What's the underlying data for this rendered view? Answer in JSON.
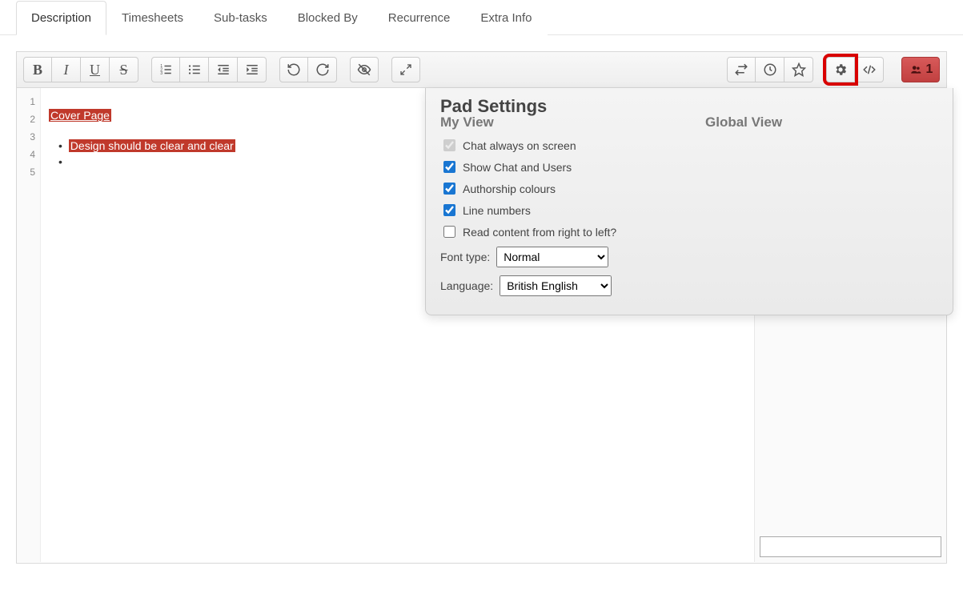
{
  "tabs": [
    {
      "label": "Description",
      "active": true
    },
    {
      "label": "Timesheets",
      "active": false
    },
    {
      "label": "Sub-tasks",
      "active": false
    },
    {
      "label": "Blocked By",
      "active": false
    },
    {
      "label": "Recurrence",
      "active": false
    },
    {
      "label": "Extra Info",
      "active": false
    }
  ],
  "toolbar": {
    "bold": "B",
    "italic": "I",
    "underline": "U",
    "strike": "S"
  },
  "users_count": "1",
  "gutter_lines": [
    "1",
    "2",
    "3",
    "4",
    "5"
  ],
  "doc": {
    "line2_text": "Cover Page",
    "line4_text": "Design should be clear and clear"
  },
  "settings": {
    "title": "Pad Settings",
    "my_view_label": "My View",
    "global_view_label": "Global View",
    "chk_chat_always": {
      "label": "Chat always on screen",
      "checked": true,
      "disabled": true
    },
    "chk_show_chat_users": {
      "label": "Show Chat and Users",
      "checked": true,
      "disabled": false
    },
    "chk_authorship": {
      "label": "Authorship colours",
      "checked": true,
      "disabled": false
    },
    "chk_line_numbers": {
      "label": "Line numbers",
      "checked": true,
      "disabled": false
    },
    "chk_rtl": {
      "label": "Read content from right to left?",
      "checked": false,
      "disabled": false
    },
    "font_label": "Font type:",
    "font_value": "Normal",
    "lang_label": "Language:",
    "lang_value": "British English"
  }
}
